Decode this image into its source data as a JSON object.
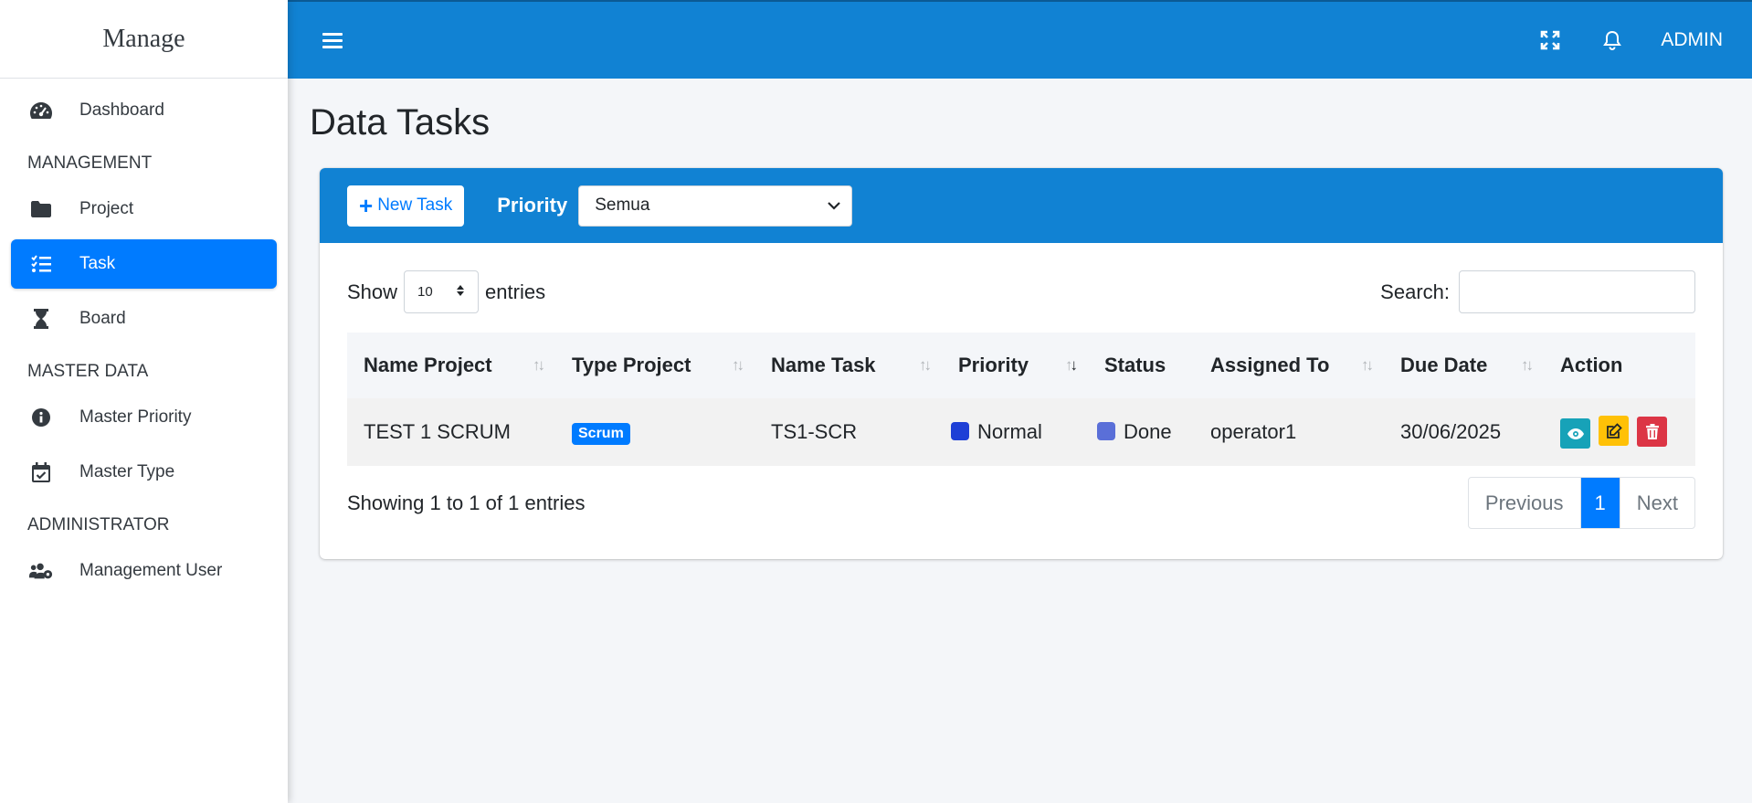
{
  "brand": "Manage",
  "sidebar": {
    "items": [
      {
        "label": "Dashboard",
        "icon": "tachometer-icon"
      },
      {
        "label": "Project",
        "icon": "folder-icon"
      },
      {
        "label": "Task",
        "icon": "tasks-icon",
        "active": true
      },
      {
        "label": "Board",
        "icon": "hourglass-icon"
      },
      {
        "label": "Master Priority",
        "icon": "info-circle-icon"
      },
      {
        "label": "Master Type",
        "icon": "calendar-check-icon"
      },
      {
        "label": "Management User",
        "icon": "users-cog-icon"
      }
    ],
    "headers": [
      "MANAGEMENT",
      "MASTER DATA",
      "ADMINISTRATOR"
    ]
  },
  "topbar": {
    "user": "ADMIN"
  },
  "page": {
    "title": "Data Tasks"
  },
  "toolbar": {
    "new_task_label": "New Task",
    "priority_label": "Priority",
    "priority_value": "Semua"
  },
  "table_controls": {
    "show_label": "Show",
    "entries_label": "entries",
    "length_value": "10",
    "search_label": "Search:",
    "search_value": ""
  },
  "table": {
    "columns": [
      "Name Project",
      "Type Project",
      "Name Task",
      "Priority",
      "Status",
      "Assigned To",
      "Due Date",
      "Action"
    ],
    "rows": [
      {
        "name_project": "TEST 1 SCRUM",
        "type_project": "Scrum",
        "name_task": "TS1-SCR",
        "priority": "Normal",
        "priority_color": "#1e3fd6",
        "status": "Done",
        "status_color": "#5a6fd8",
        "assigned_to": "operator1",
        "due_date": "30/06/2025"
      }
    ]
  },
  "footer": {
    "info": "Showing 1 to 1 of 1 entries",
    "previous": "Previous",
    "page": "1",
    "next": "Next"
  },
  "colors": {
    "primary": "#007bff",
    "header_blue": "#1182d3",
    "view": "#17a2b8",
    "edit": "#ffc107",
    "delete": "#dc3545"
  }
}
